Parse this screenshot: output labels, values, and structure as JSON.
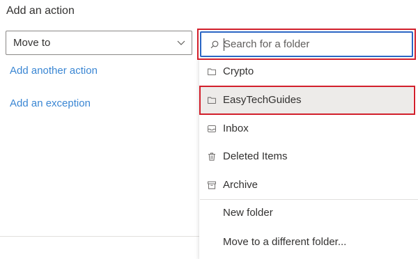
{
  "heading": "Add an action",
  "action_select": {
    "value": "Move to",
    "icon": "chevron-down-icon"
  },
  "links": {
    "add_action": "Add another action",
    "add_exception": "Add an exception"
  },
  "folder_picker": {
    "search": {
      "placeholder": "Search for a folder",
      "value": "",
      "icon": "search-icon"
    },
    "folders": [
      {
        "label": "Crypto",
        "icon": "folder-icon",
        "selected": false
      },
      {
        "label": "EasyTechGuides",
        "icon": "folder-icon",
        "selected": true
      },
      {
        "label": "Inbox",
        "icon": "inbox-icon",
        "selected": false
      },
      {
        "label": "Deleted Items",
        "icon": "trash-icon",
        "selected": false
      },
      {
        "label": "Archive",
        "icon": "archive-icon",
        "selected": false
      }
    ],
    "actions": [
      {
        "label": "New folder"
      },
      {
        "label": "Move to a different folder..."
      }
    ]
  },
  "colors": {
    "link": "#3a86d3",
    "highlight_border": "#d21f2b",
    "focus_border": "#2b66c5",
    "selected_bg": "#edebe9"
  }
}
